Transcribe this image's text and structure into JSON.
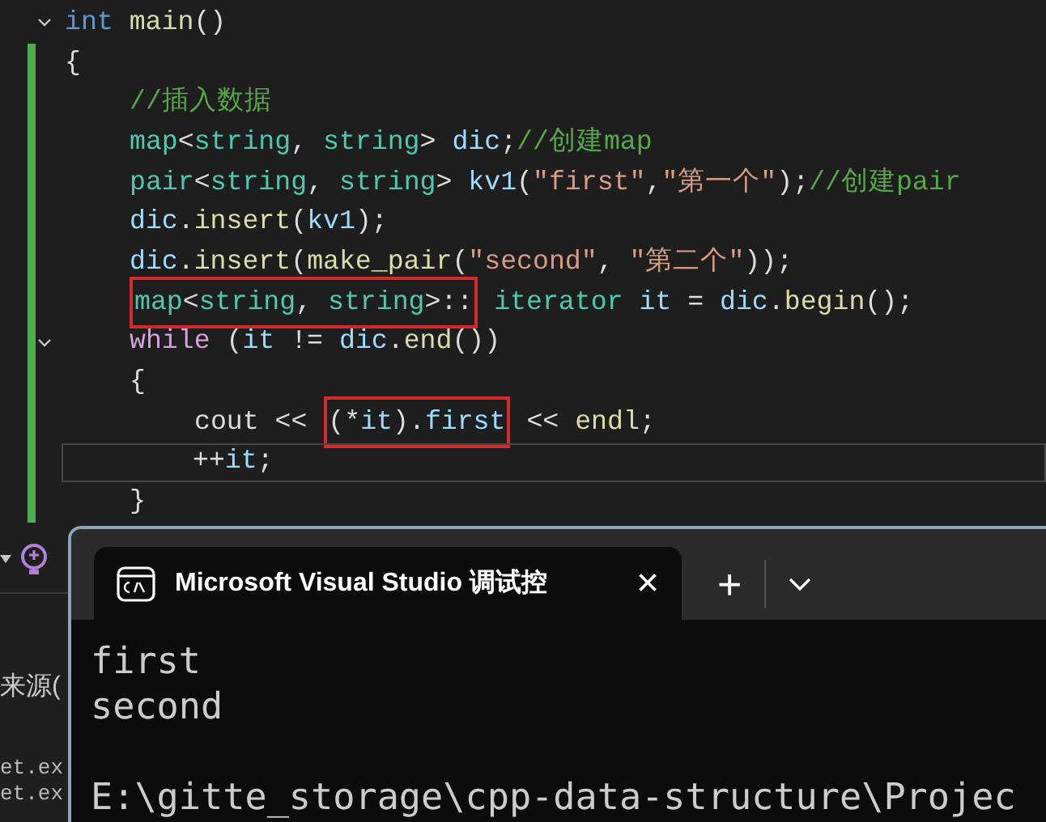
{
  "editor": {
    "lines": [
      {
        "collapsible": true,
        "modified": false,
        "current": false,
        "segments": [
          {
            "highlighted": false,
            "tokens": [
              {
                "text": "int ",
                "kind": "keyword"
              },
              {
                "text": "main",
                "kind": "function"
              },
              {
                "text": "()",
                "kind": "plain"
              }
            ]
          }
        ]
      },
      {
        "collapsible": false,
        "modified": true,
        "current": false,
        "segments": [
          {
            "highlighted": false,
            "tokens": [
              {
                "text": "{",
                "kind": "plain"
              }
            ]
          }
        ],
        "children": [
          {
            "collapsible": false,
            "modified": true,
            "current": false,
            "segments": [
              {
                "highlighted": false,
                "tokens": [
                  {
                    "text": "//插入数据",
                    "kind": "comment"
                  }
                ]
              }
            ]
          },
          {
            "collapsible": false,
            "modified": true,
            "current": false,
            "segments": [
              {
                "highlighted": false,
                "tokens": [
                  {
                    "text": "map",
                    "kind": "type"
                  },
                  {
                    "text": "<",
                    "kind": "plain"
                  },
                  {
                    "text": "string",
                    "kind": "type"
                  },
                  {
                    "text": ", ",
                    "kind": "plain"
                  },
                  {
                    "text": "string",
                    "kind": "type"
                  },
                  {
                    "text": "> ",
                    "kind": "plain"
                  },
                  {
                    "text": "dic",
                    "kind": "variable"
                  },
                  {
                    "text": ";",
                    "kind": "plain"
                  },
                  {
                    "text": "//创建map",
                    "kind": "comment"
                  }
                ]
              }
            ]
          },
          {
            "collapsible": false,
            "modified": true,
            "current": false,
            "segments": [
              {
                "highlighted": false,
                "tokens": [
                  {
                    "text": "pair",
                    "kind": "type"
                  },
                  {
                    "text": "<",
                    "kind": "plain"
                  },
                  {
                    "text": "string",
                    "kind": "type"
                  },
                  {
                    "text": ", ",
                    "kind": "plain"
                  },
                  {
                    "text": "string",
                    "kind": "type"
                  },
                  {
                    "text": "> ",
                    "kind": "plain"
                  },
                  {
                    "text": "kv1",
                    "kind": "variable"
                  },
                  {
                    "text": "(",
                    "kind": "plain"
                  },
                  {
                    "text": "\"first\"",
                    "kind": "string"
                  },
                  {
                    "text": ",",
                    "kind": "plain"
                  },
                  {
                    "text": "\"第一个\"",
                    "kind": "string"
                  },
                  {
                    "text": ");",
                    "kind": "plain"
                  },
                  {
                    "text": "//创建pair",
                    "kind": "comment"
                  }
                ]
              }
            ]
          },
          {
            "collapsible": false,
            "modified": true,
            "current": false,
            "segments": [
              {
                "highlighted": false,
                "tokens": [
                  {
                    "text": "dic",
                    "kind": "variable"
                  },
                  {
                    "text": ".",
                    "kind": "plain"
                  },
                  {
                    "text": "insert",
                    "kind": "function"
                  },
                  {
                    "text": "(",
                    "kind": "plain"
                  },
                  {
                    "text": "kv1",
                    "kind": "variable"
                  },
                  {
                    "text": ");",
                    "kind": "plain"
                  }
                ]
              }
            ]
          },
          {
            "collapsible": false,
            "modified": true,
            "current": false,
            "segments": [
              {
                "highlighted": false,
                "tokens": [
                  {
                    "text": "dic",
                    "kind": "variable"
                  },
                  {
                    "text": ".",
                    "kind": "plain"
                  },
                  {
                    "text": "insert",
                    "kind": "function"
                  },
                  {
                    "text": "(",
                    "kind": "plain"
                  },
                  {
                    "text": "make_pair",
                    "kind": "function"
                  },
                  {
                    "text": "(",
                    "kind": "plain"
                  },
                  {
                    "text": "\"second\"",
                    "kind": "string"
                  },
                  {
                    "text": ", ",
                    "kind": "plain"
                  },
                  {
                    "text": "\"第二个\"",
                    "kind": "string"
                  },
                  {
                    "text": "));",
                    "kind": "plain"
                  }
                ]
              }
            ]
          },
          {
            "collapsible": false,
            "modified": true,
            "current": false,
            "segments": [
              {
                "highlighted": true,
                "tokens": [
                  {
                    "text": "map",
                    "kind": "type"
                  },
                  {
                    "text": "<",
                    "kind": "plain"
                  },
                  {
                    "text": "string",
                    "kind": "type"
                  },
                  {
                    "text": ", ",
                    "kind": "plain"
                  },
                  {
                    "text": "string",
                    "kind": "type"
                  },
                  {
                    "text": ">::",
                    "kind": "plain"
                  }
                ]
              },
              {
                "highlighted": false,
                "tokens": [
                  {
                    "text": " iterator",
                    "kind": "type"
                  },
                  {
                    "text": " it",
                    "kind": "variable"
                  },
                  {
                    "text": " = ",
                    "kind": "plain"
                  },
                  {
                    "text": "dic",
                    "kind": "variable"
                  },
                  {
                    "text": ".",
                    "kind": "plain"
                  },
                  {
                    "text": "begin",
                    "kind": "function"
                  },
                  {
                    "text": "();",
                    "kind": "plain"
                  }
                ]
              }
            ]
          },
          {
            "collapsible": true,
            "modified": true,
            "current": false,
            "segments": [
              {
                "highlighted": false,
                "tokens": [
                  {
                    "text": "while",
                    "kind": "control"
                  },
                  {
                    "text": " (",
                    "kind": "plain"
                  },
                  {
                    "text": "it",
                    "kind": "variable"
                  },
                  {
                    "text": " != ",
                    "kind": "plain"
                  },
                  {
                    "text": "dic",
                    "kind": "variable"
                  },
                  {
                    "text": ".",
                    "kind": "plain"
                  },
                  {
                    "text": "end",
                    "kind": "function"
                  },
                  {
                    "text": "())",
                    "kind": "plain"
                  }
                ]
              }
            ]
          },
          {
            "collapsible": false,
            "modified": true,
            "current": false,
            "segments": [
              {
                "highlighted": false,
                "tokens": [
                  {
                    "text": "{",
                    "kind": "plain"
                  }
                ]
              }
            ],
            "children": [
              {
                "collapsible": false,
                "modified": true,
                "current": false,
                "segments": [
                  {
                    "highlighted": false,
                    "tokens": [
                      {
                        "text": "cout << ",
                        "kind": "plain"
                      }
                    ]
                  },
                  {
                    "highlighted": true,
                    "tokens": [
                      {
                        "text": "(*",
                        "kind": "plain"
                      },
                      {
                        "text": "it",
                        "kind": "variable"
                      },
                      {
                        "text": ").",
                        "kind": "plain"
                      },
                      {
                        "text": "first",
                        "kind": "variable"
                      }
                    ]
                  },
                  {
                    "highlighted": false,
                    "tokens": [
                      {
                        "text": " << ",
                        "kind": "plain"
                      },
                      {
                        "text": "endl",
                        "kind": "function"
                      },
                      {
                        "text": ";",
                        "kind": "plain"
                      }
                    ]
                  }
                ]
              },
              {
                "collapsible": false,
                "modified": true,
                "current": true,
                "segments": [
                  {
                    "highlighted": false,
                    "tokens": [
                      {
                        "text": "++",
                        "kind": "plain"
                      },
                      {
                        "text": "it",
                        "kind": "variable"
                      },
                      {
                        "text": ";",
                        "kind": "plain"
                      }
                    ]
                  }
                ]
              }
            ]
          },
          {
            "collapsible": false,
            "modified": true,
            "current": false,
            "segments": [
              {
                "highlighted": false,
                "tokens": [
                  {
                    "text": "}",
                    "kind": "plain"
                  }
                ]
              }
            ]
          }
        ]
      }
    ]
  },
  "side_panel": {
    "texts": [
      {
        "text": "来源(",
        "kind": "label"
      },
      {
        "text": "et.ex",
        "kind": "code"
      },
      {
        "text": "et.ex",
        "kind": "code"
      }
    ]
  },
  "console": {
    "tab": {
      "title": "Microsoft Visual Studio 调试控",
      "close": "×"
    },
    "new_tab": "+",
    "output": [
      "first",
      "second"
    ],
    "path": "E:\\gitte_storage\\cpp-data-structure\\Projec"
  }
}
